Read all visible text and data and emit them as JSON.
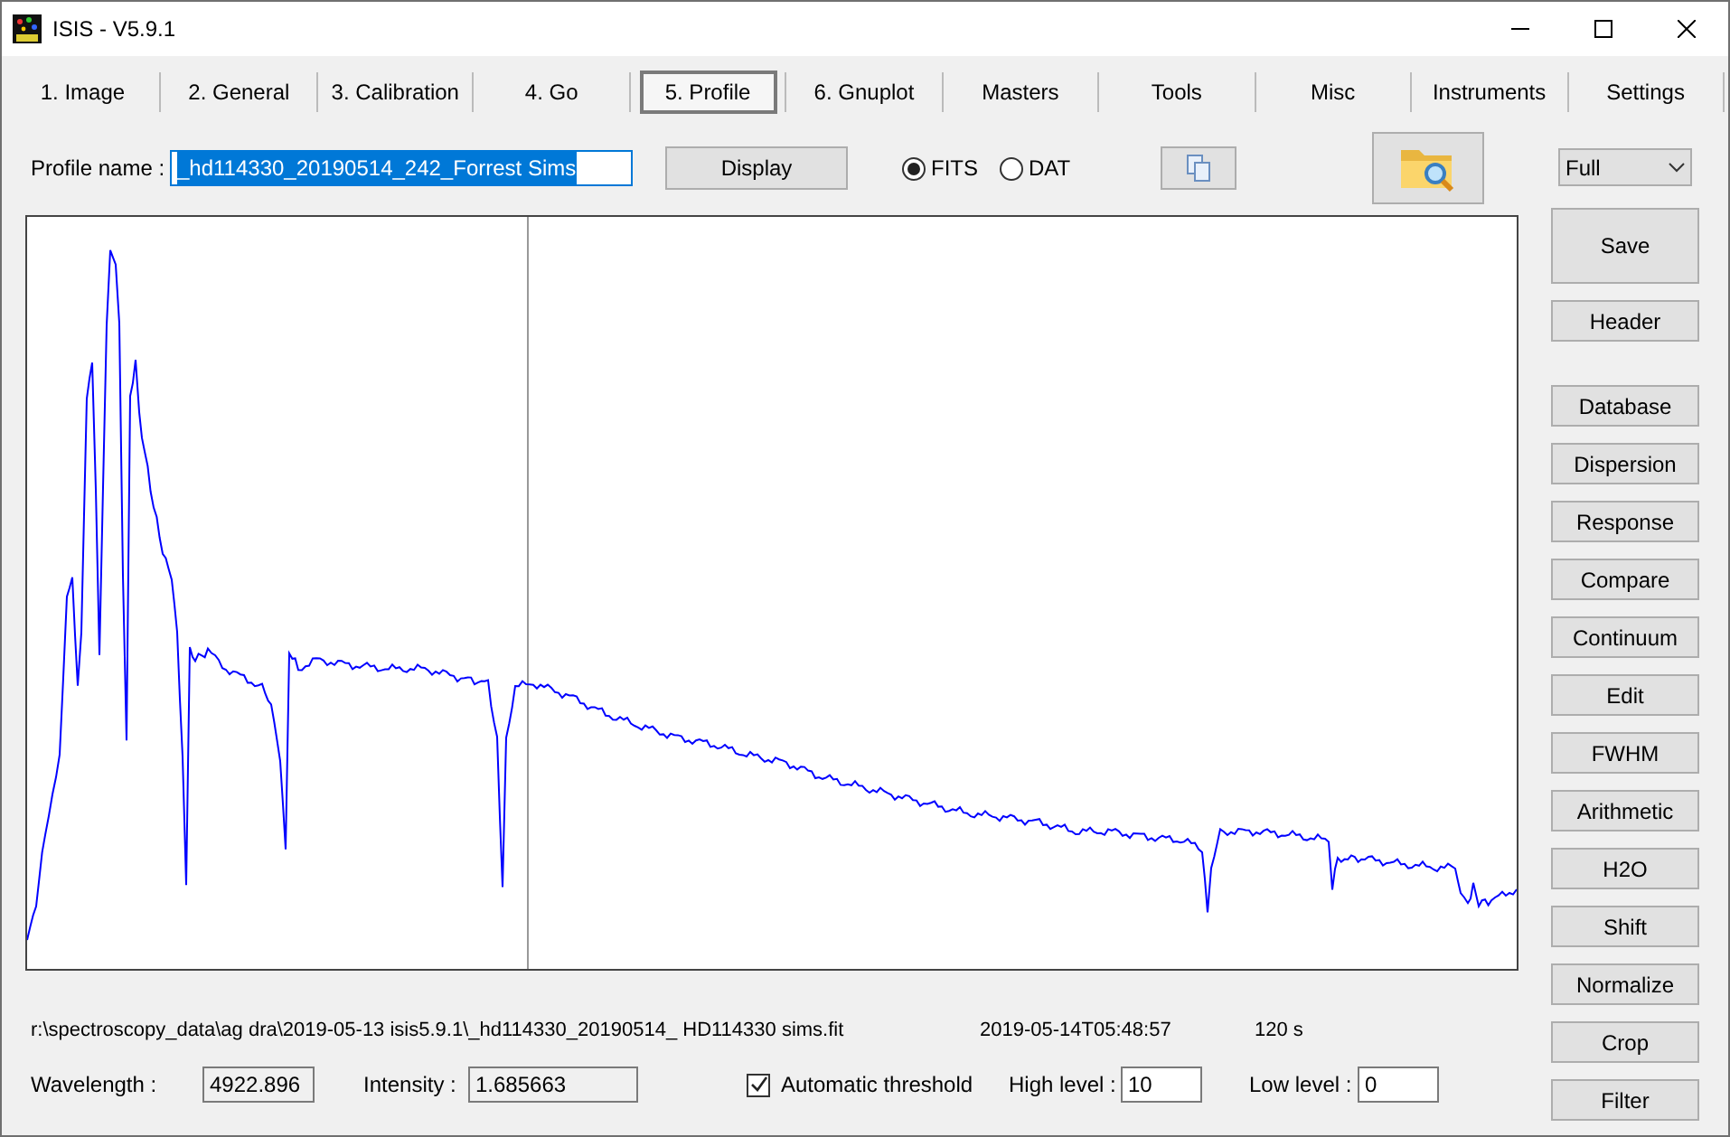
{
  "window": {
    "title": "ISIS - V5.9.1"
  },
  "tabs": [
    {
      "label": "1. Image",
      "selected": false
    },
    {
      "label": "2. General",
      "selected": false
    },
    {
      "label": "3. Calibration",
      "selected": false
    },
    {
      "label": "4. Go",
      "selected": false
    },
    {
      "label": "5. Profile",
      "selected": true
    },
    {
      "label": "6. Gnuplot",
      "selected": false
    },
    {
      "label": "Masters",
      "selected": false
    },
    {
      "label": "Tools",
      "selected": false
    },
    {
      "label": "Misc",
      "selected": false
    },
    {
      "label": "Instruments",
      "selected": false
    },
    {
      "label": "Settings",
      "selected": false
    }
  ],
  "profile": {
    "label": "Profile name :",
    "value": "_hd114330_20190514_242_Forrest Sims",
    "display_button": "Display",
    "formats": [
      {
        "label": "FITS",
        "selected": true
      },
      {
        "label": "DAT",
        "selected": false
      }
    ]
  },
  "view_dropdown": {
    "value": "Full"
  },
  "side_buttons": [
    {
      "label": "Save",
      "kind": "large"
    },
    {
      "label": "Header",
      "kind": "small"
    },
    {
      "label": "Database",
      "kind": "spaced"
    },
    {
      "label": "Dispersion",
      "kind": "small"
    },
    {
      "label": "Response",
      "kind": "small"
    },
    {
      "label": "Compare",
      "kind": "small"
    },
    {
      "label": "Continuum",
      "kind": "small"
    },
    {
      "label": "Edit",
      "kind": "small"
    },
    {
      "label": "FWHM",
      "kind": "small"
    },
    {
      "label": "Arithmetic",
      "kind": "small"
    },
    {
      "label": "H2O",
      "kind": "small"
    },
    {
      "label": "Shift",
      "kind": "small"
    },
    {
      "label": "Normalize",
      "kind": "small"
    },
    {
      "label": "Crop",
      "kind": "small"
    },
    {
      "label": "Filter",
      "kind": "small"
    }
  ],
  "info": {
    "file_path": "r:\\spectroscopy_data\\ag dra\\2019-05-13 isis5.9.1\\_hd114330_20190514_ HD114330 sims.fit",
    "date": "2019-05-14T05:48:57",
    "exposure": "120 s"
  },
  "readouts": {
    "wavelength_label": "Wavelength :",
    "wavelength": "4922.896",
    "intensity_label": "Intensity :",
    "intensity": "1.685663",
    "threshold": {
      "label": "Automatic threshold",
      "checked": true
    },
    "high_label": "High level :",
    "high": "10",
    "low_label": "Low level :",
    "low": "0"
  }
}
